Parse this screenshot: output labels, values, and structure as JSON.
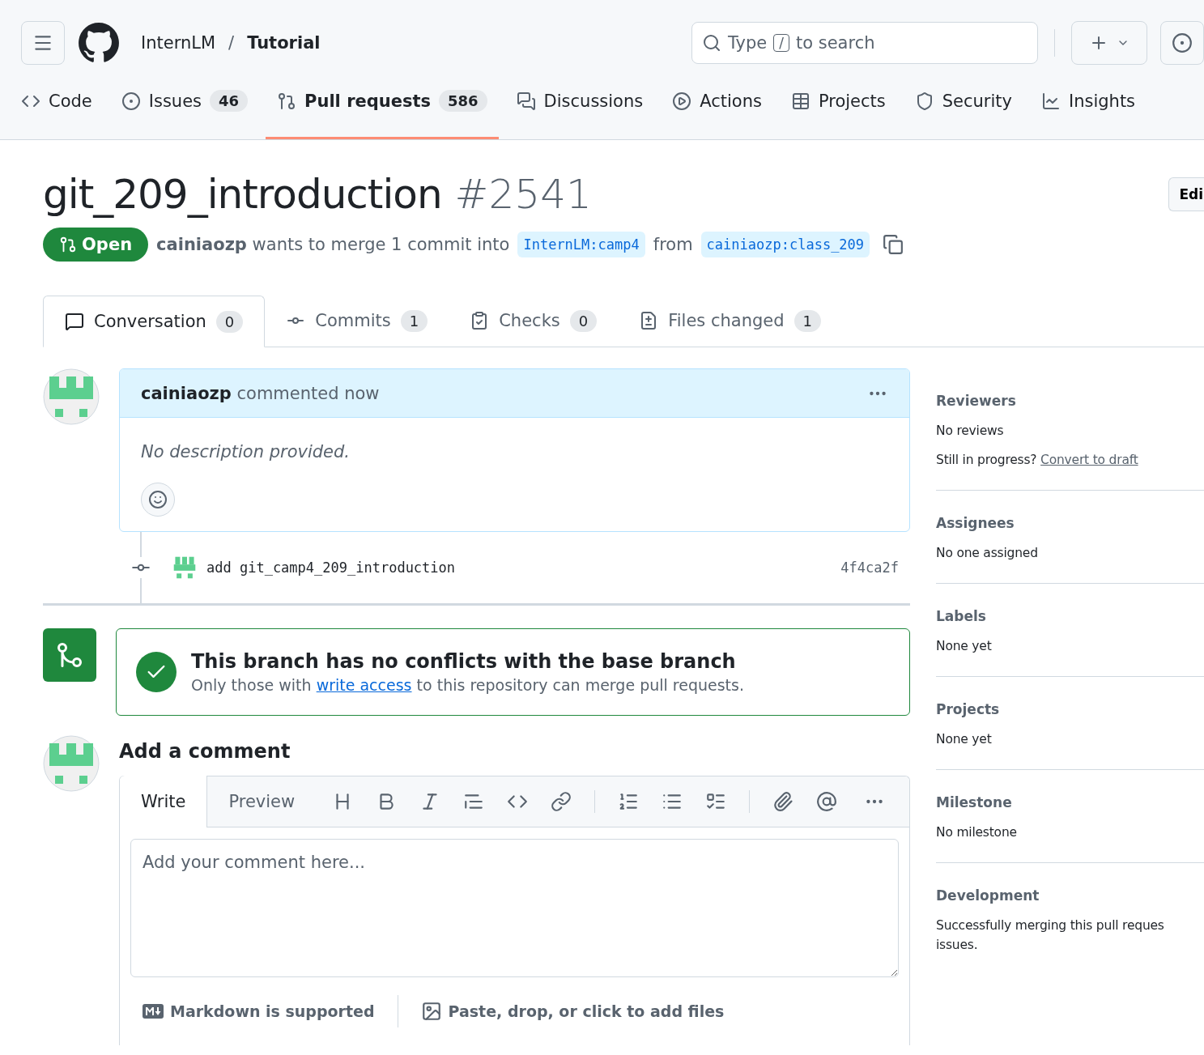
{
  "header": {
    "owner": "InternLM",
    "separator": "/",
    "repo": "Tutorial",
    "search": {
      "before": "Type",
      "key": "/",
      "after": "to search"
    }
  },
  "repo_tabs": [
    {
      "label": "Code",
      "selected": false
    },
    {
      "label": "Issues",
      "count": "46",
      "selected": false
    },
    {
      "label": "Pull requests",
      "count": "586",
      "selected": true
    },
    {
      "label": "Discussions",
      "selected": false
    },
    {
      "label": "Actions",
      "selected": false
    },
    {
      "label": "Projects",
      "selected": false
    },
    {
      "label": "Security",
      "selected": false
    },
    {
      "label": "Insights",
      "selected": false
    }
  ],
  "pr": {
    "title": "git_209_introduction",
    "number": "#2541",
    "edit": "Edi",
    "state": "Open",
    "author": "cainiaozp",
    "summary": "wants to merge 1 commit into",
    "base": "InternLM:camp4",
    "from": "from",
    "head": "cainiaozp:class_209"
  },
  "pr_tabs": [
    {
      "label": "Conversation",
      "count": "0",
      "selected": true
    },
    {
      "label": "Commits",
      "count": "1",
      "selected": false
    },
    {
      "label": "Checks",
      "count": "0",
      "selected": false
    },
    {
      "label": "Files changed",
      "count": "1",
      "selected": false
    }
  ],
  "comment": {
    "author": "cainiaozp",
    "action": "commented now",
    "body": "No description provided."
  },
  "commit": {
    "message": "add git_camp4_209_introduction",
    "sha": "4f4ca2f"
  },
  "merge_box": {
    "title": "This branch has no conflicts with the base branch",
    "text_before": "Only those with",
    "link": "write access",
    "text_after": "to this repository can merge pull requests."
  },
  "add_comment": {
    "title": "Add a comment",
    "tabs": [
      {
        "label": "Write",
        "selected": true
      },
      {
        "label": "Preview",
        "selected": false
      }
    ],
    "placeholder": "Add your comment here...",
    "markdown_note": "Markdown is supported",
    "files_note": "Paste, drop, or click to add files"
  },
  "sidebar": [
    {
      "heading": "Reviewers",
      "lines": [
        "No reviews"
      ],
      "prompt": "Still in progress?",
      "link": "Convert to draft"
    },
    {
      "heading": "Assignees",
      "lines": [
        "No one assigned"
      ]
    },
    {
      "heading": "Labels",
      "lines": [
        "None yet"
      ]
    },
    {
      "heading": "Projects",
      "lines": [
        "None yet"
      ]
    },
    {
      "heading": "Milestone",
      "lines": [
        "No milestone"
      ]
    },
    {
      "heading": "Development",
      "lines": [
        "Successfully merging this pull reques",
        "issues."
      ]
    }
  ]
}
